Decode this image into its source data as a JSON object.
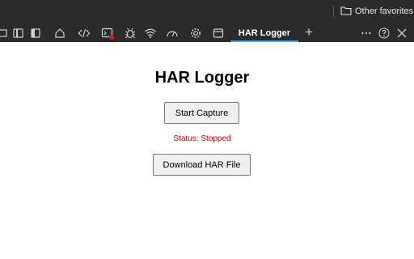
{
  "browser": {
    "favorites_bar": {
      "folder_label": "Other favorites",
      "folder_icon": "folder-icon"
    },
    "devtools": {
      "toolbar_icons": [
        "device-emulation-icon",
        "dock-icon",
        "sidebar-icon",
        "welcome-home-icon",
        "elements-code-icon",
        "console-icon",
        "debugger-bug-icon",
        "network-wifi-icon",
        "performance-gauge-icon",
        "settings-gear-icon",
        "application-panel-icon"
      ],
      "active_tab": "HAR Logger",
      "add_tab_symbol": "+",
      "console_badge_color": "#e81123",
      "accent_color": "#4ba0ff"
    }
  },
  "page": {
    "title": "HAR Logger",
    "start_button": "Start Capture",
    "status": "Status: Stopped",
    "status_color": "#cc0000",
    "download_button": "Download HAR File"
  }
}
